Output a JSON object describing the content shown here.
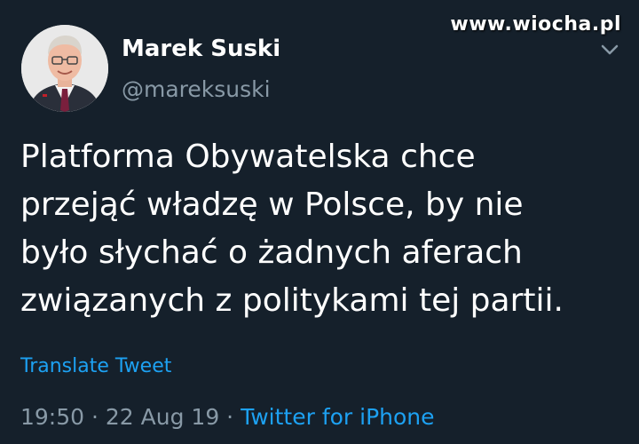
{
  "watermark": "www.wiocha.pl",
  "author": {
    "name": "Marek Suski",
    "handle": "@mareksuski"
  },
  "tweet": {
    "lines": [
      "Platforma Obywatelska chce",
      "przejąć władzę w Polsce, by nie",
      "było słychać o żadnych aferach",
      "związanych z politykami tej partii."
    ]
  },
  "translate_label": "Translate Tweet",
  "meta": {
    "time": "19:50",
    "separator": " · ",
    "date": "22 Aug 19",
    "source": "Twitter for iPhone"
  },
  "icons": {
    "menu": "chevron-down-icon"
  },
  "colors": {
    "background": "#15202b",
    "text": "#ffffff",
    "muted": "#8899a6",
    "link": "#1da1f2"
  }
}
